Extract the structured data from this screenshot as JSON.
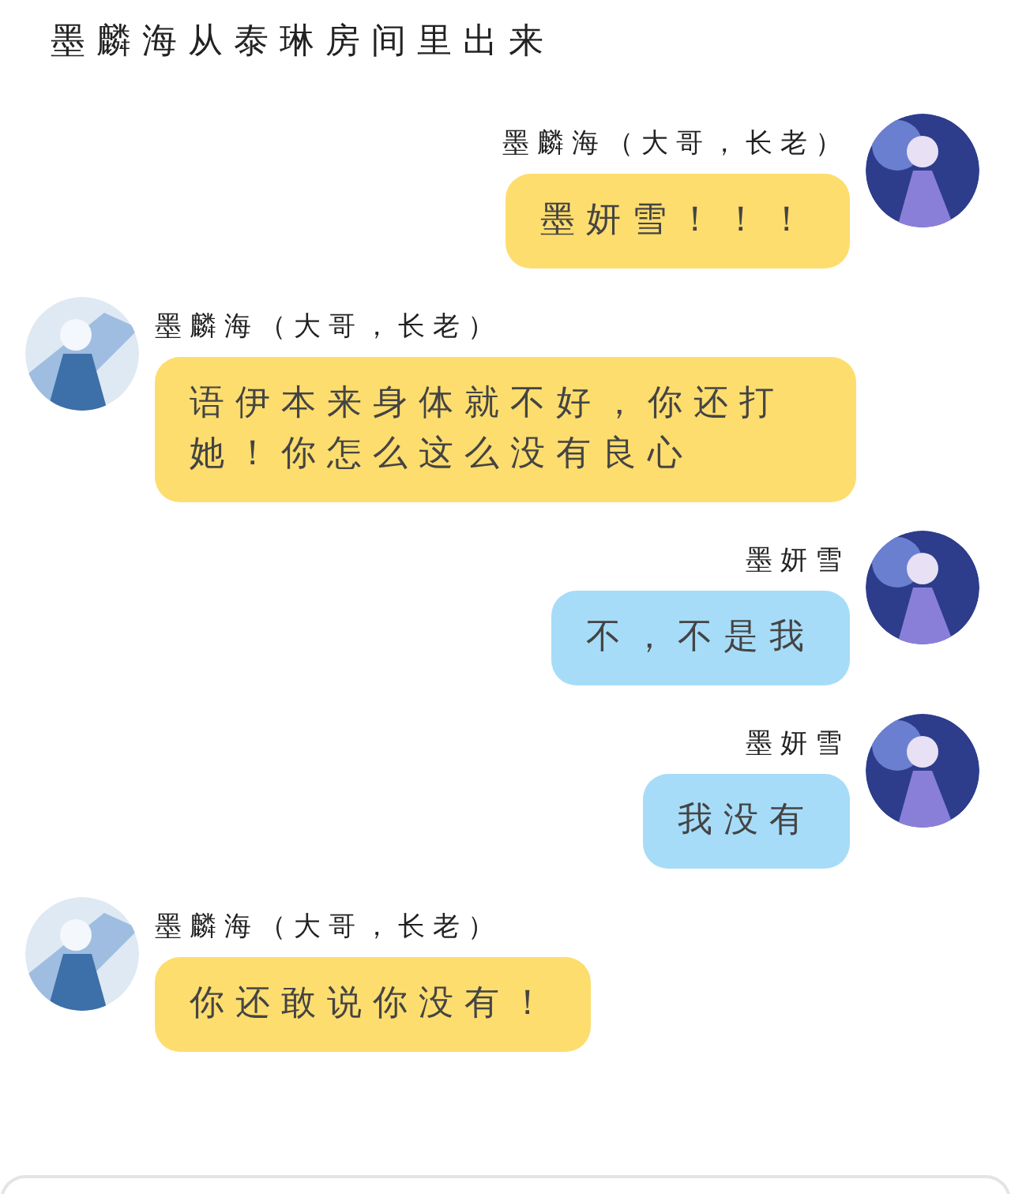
{
  "title": "墨麟海从泰琳房间里出来",
  "messages": [
    {
      "sender": "墨麟海（大哥，长老）",
      "kind": "outgoing",
      "color": "#fddd6e",
      "text": "墨妍雪！！！"
    },
    {
      "sender": "墨麟海（大哥，长老）",
      "kind": "incoming",
      "color": "#fddd6e",
      "text": "语伊本来身体就不好，你还打她！你怎么这么没有良心"
    },
    {
      "sender": "墨妍雪",
      "kind": "outgoing",
      "color": "#a6dcf8",
      "text": "不，不是我"
    },
    {
      "sender": "墨妍雪",
      "kind": "outgoing",
      "color": "#a6dcf8",
      "text": "我没有"
    },
    {
      "sender": "墨麟海（大哥，长老）",
      "kind": "incoming",
      "color": "#fddd6e",
      "text": "你还敢说你没有！"
    }
  ]
}
